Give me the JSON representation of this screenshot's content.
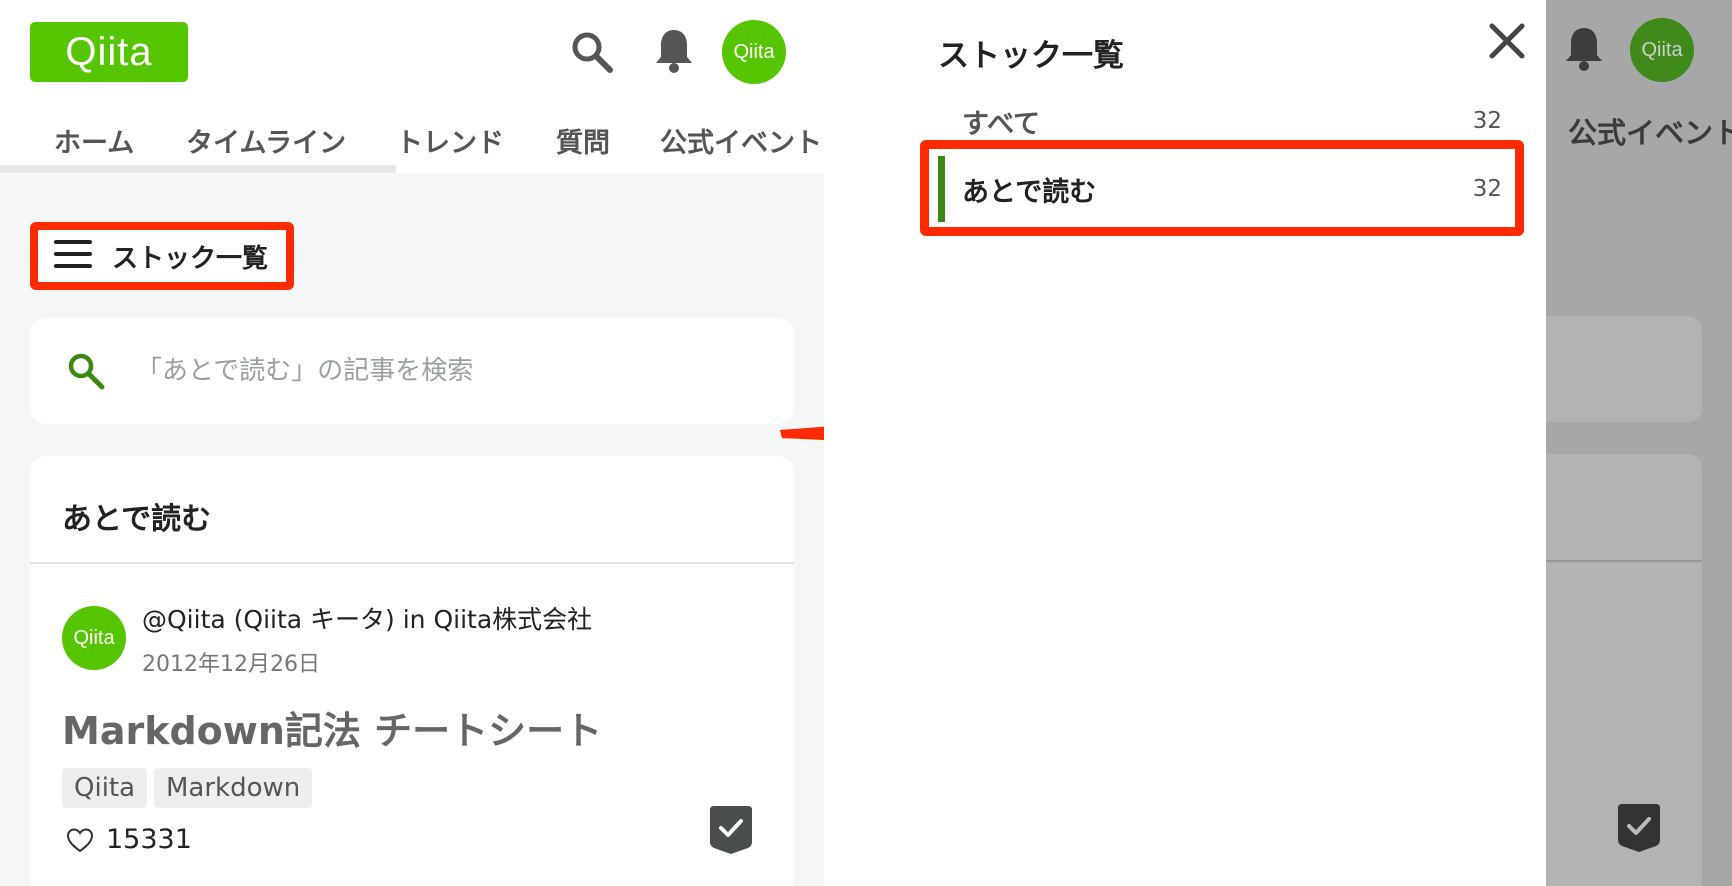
{
  "header": {
    "logo_text": "Qiita",
    "avatar_text": "Qiita",
    "icons": [
      "search-icon",
      "bell-icon"
    ]
  },
  "nav": {
    "tabs": [
      "ホーム",
      "タイムライン",
      "トレンド",
      "質問",
      "公式イベント"
    ]
  },
  "stock_list_button": {
    "label": "ストック一覧",
    "icon": "hamburger-icon"
  },
  "search": {
    "placeholder": "「あとで読む」の記事を検索",
    "value": ""
  },
  "card": {
    "title": "あとで読む",
    "article": {
      "avatar_text": "Qiita",
      "author": "@Qiita (Qiita キータ) in Qiita株式会社",
      "date": "2012年12月26日",
      "title": "Markdown記法 チートシート",
      "tags": [
        "Qiita",
        "Markdown"
      ],
      "likes": "15331"
    }
  },
  "drawer": {
    "title": "ストック一覧",
    "items": [
      {
        "name": "すべて",
        "count": "32"
      },
      {
        "name": "あとで読む",
        "count": "32"
      }
    ]
  },
  "overlay": {
    "nav_tab": "公式イベント",
    "avatar_text": "Qiita"
  },
  "colors": {
    "brand_green": "#55c500",
    "highlight_red": "#ff2a00",
    "selected_bar": "#3a8a12"
  }
}
